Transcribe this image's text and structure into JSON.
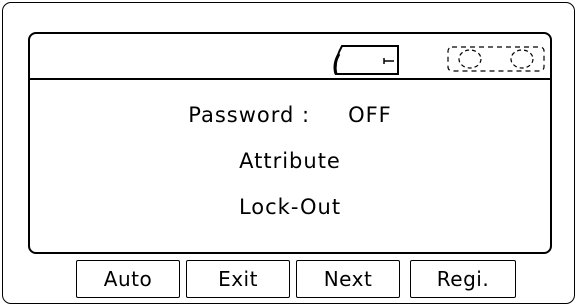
{
  "status_bar": {
    "icons": [
      "battery-icon",
      "cassette-icon"
    ]
  },
  "menu": {
    "password_label": "Password :",
    "password_value": "OFF",
    "attribute_label": "Attribute",
    "lockout_label": "Lock-Out"
  },
  "buttons": {
    "auto_label": "Auto",
    "exit_label": "Exit",
    "next_label": "Next",
    "regi_label": "Regi."
  }
}
